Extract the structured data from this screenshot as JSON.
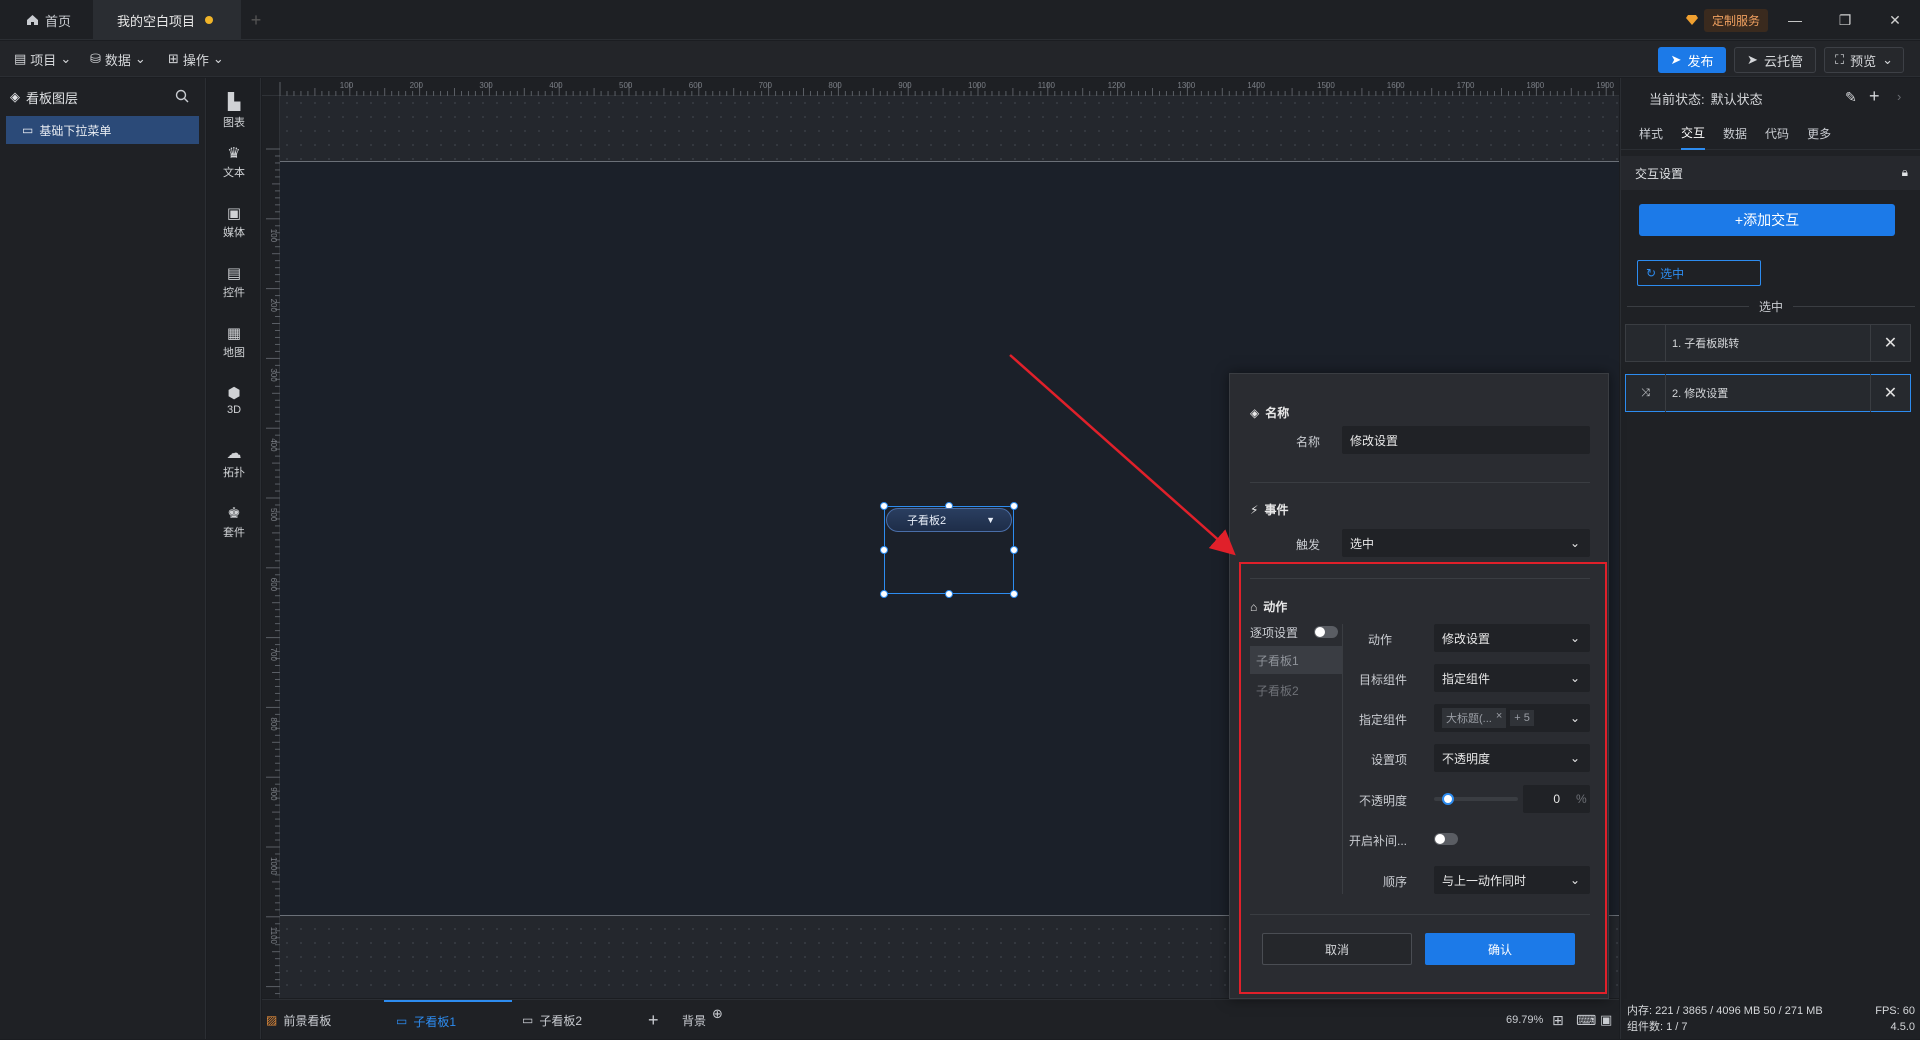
{
  "titlebar": {
    "home_tab": "首页",
    "project_tab": "我的空白项目",
    "custom_service": "定制服务"
  },
  "toolbar": {
    "project_menu": "项目",
    "data_menu": "数据",
    "operate_menu": "操作",
    "publish": "发布",
    "cloud_host": "云托管",
    "preview": "预览"
  },
  "left_panel": {
    "title": "看板图层",
    "layer_item": "基础下拉菜单"
  },
  "components": [
    {
      "label": "图表",
      "icon": "chart-icon"
    },
    {
      "label": "文本",
      "icon": "text-icon"
    },
    {
      "label": "媒体",
      "icon": "media-icon"
    },
    {
      "label": "控件",
      "icon": "control-icon"
    },
    {
      "label": "地图",
      "icon": "map-icon"
    },
    {
      "label": "3D",
      "icon": "cube-icon"
    },
    {
      "label": "拓扑",
      "icon": "topology-icon"
    },
    {
      "label": "套件",
      "icon": "suite-icon"
    }
  ],
  "ruler": {
    "top_ticks": [
      "100",
      "200",
      "300",
      "400",
      "500",
      "600",
      "700",
      "800",
      "900",
      "1000",
      "1100",
      "1200",
      "1300",
      "1400",
      "1500",
      "1600",
      "1700",
      "1800",
      "1900"
    ],
    "left_ticks": [
      "100",
      "200",
      "300",
      "400",
      "500",
      "600",
      "700",
      "800",
      "900",
      "1000",
      "1100"
    ]
  },
  "canvas": {
    "widget_label": "子看板2"
  },
  "bottom_tabs": {
    "foreground": "前景看板",
    "sub1": "子看板1",
    "sub2": "子看板2",
    "background": "背景",
    "zoom": "69.79%"
  },
  "right_panel": {
    "state_label": "当前状态:",
    "state_value": "默认状态",
    "tabs": [
      "样式",
      "交互",
      "数据",
      "代码",
      "更多"
    ],
    "section_title": "交互设置",
    "add_interaction": "+添加交互",
    "event_chip": "选中",
    "divider_label": "选中",
    "actions": [
      "1. 子看板跳转",
      "2. 修改设置"
    ],
    "footer_memory": "内存: 221 / 3865 / 4096 MB  50 / 271 MB",
    "footer_fps": "FPS: 60",
    "footer_components": "组件数: 1 / 7",
    "footer_version": "4.5.0"
  },
  "modal": {
    "name_section": "名称",
    "name_label": "名称",
    "name_value": "修改设置",
    "event_section": "事件",
    "trigger_label": "触发",
    "trigger_value": "选中",
    "action_section": "动作",
    "per_item_label": "逐项设置",
    "subtabs": [
      "子看板1",
      "子看板2"
    ],
    "action_label": "动作",
    "action_value": "修改设置",
    "target_label": "目标组件",
    "target_value": "指定组件",
    "specified_label": "指定组件",
    "specified_tag": "大标题(...",
    "specified_more": "+ 5",
    "setting_label": "设置项",
    "setting_value": "不透明度",
    "opacity_label": "不透明度",
    "opacity_value": "0",
    "opacity_unit": "%",
    "tween_label": "开启补间...",
    "order_label": "顺序",
    "order_value": "与上一动作同时",
    "cancel": "取消",
    "confirm": "确认"
  },
  "colors": {
    "accent": "#1c7ae8",
    "annotation": "#e0202a"
  }
}
